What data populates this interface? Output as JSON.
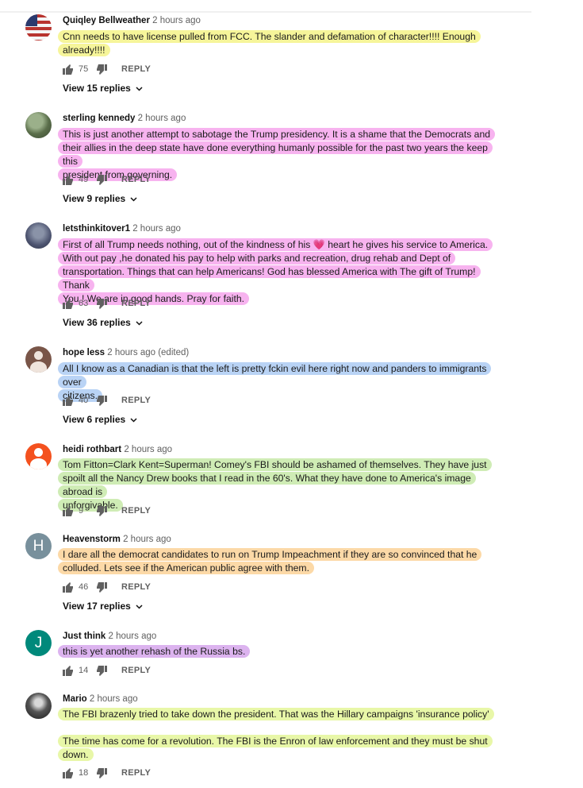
{
  "colors": {
    "yellow": "#f6f59a",
    "pink": "#f7b3ef",
    "blue": "#b9d3f5",
    "green": "#cfecb5",
    "orange": "#fcd9a7",
    "purple": "#dcb3ef",
    "lime": "#e8f7a8"
  },
  "reply_label": "REPLY",
  "comments": [
    {
      "author": "Quiqley Bellweather",
      "time": "2 hours ago",
      "lines": [
        "Cnn needs to have license pulled  from FCC. The slander and defamation of character!!!! Enough",
        "already!!!!"
      ],
      "likes": "75",
      "view_replies": "View 15 replies",
      "avatar": "flag-avatar"
    },
    {
      "author": "sterling kennedy",
      "time": "2 hours ago",
      "lines": [
        "This is just another attempt to sabotage the Trump presidency. It is a shame that the Democrats and",
        "their allies in the deep state have done everything humanly possible for the past two years the keep this",
        "president from governing."
      ],
      "likes": "49",
      "view_replies": "View 9 replies",
      "avatar": "nature-avatar"
    },
    {
      "author": "letsthinkitover1",
      "time": "2 hours ago",
      "lines": [
        "First of all Trump needs nothing, out of the kindness of his 💗 heart he gives his service to America.",
        "With out pay ,he donated his pay to help with parks and recreation, drug rehab and Dept of",
        "transportation. Things that can help Americans! God has blessed America with The gift of Trump! Thank",
        "You !  We are in good hands. Pray for faith."
      ],
      "likes": "63",
      "view_replies": "View 36 replies",
      "avatar": "group-avatar"
    },
    {
      "author": "hope less",
      "time": "2 hours ago (edited)",
      "lines": [
        "All I know as a Canadian is that the left is pretty fckin evil here right now and panders to immigrants over",
        "citizens."
      ],
      "likes": "40",
      "view_replies": "View 6 replies",
      "avatar": "default-avatar"
    },
    {
      "author": "heidi rothbart",
      "time": "2 hours ago",
      "lines": [
        "Tom Fitton=Clark Kent=Superman!  Comey's FBI should be ashamed of themselves.  They have just",
        "spoilt all the Nancy Drew books that I read in the 60's. What they have done to America's image abroad is",
        "unforgivable."
      ],
      "likes": "9",
      "avatar": "default-avatar-orange"
    },
    {
      "author": "Heavenstorm",
      "time": "2 hours ago",
      "lines": [
        "I dare all the democrat candidates to run on Trump Impeachment if they are so convinced that he",
        "colluded. Lets see if the American public agree with them."
      ],
      "likes": "46",
      "view_replies": "View 17 replies",
      "avatar": "letter-avatar",
      "initial": "H"
    },
    {
      "author": "Just think",
      "time": "2 hours ago",
      "lines": [
        "this is yet another rehash of the Russia bs."
      ],
      "likes": "14",
      "avatar": "letter-avatar",
      "initial": "J"
    },
    {
      "author": "Mario",
      "time": "2 hours ago",
      "lines": [
        "The FBI brazenly tried to take down the president. That was the Hillary campaigns 'insurance policy'"
      ],
      "lines2": [
        "The time has come for a revolution. The FBI is the Enron of law enforcement and they must be shut",
        "down."
      ],
      "likes": "18",
      "avatar": "photo-avatar"
    }
  ]
}
